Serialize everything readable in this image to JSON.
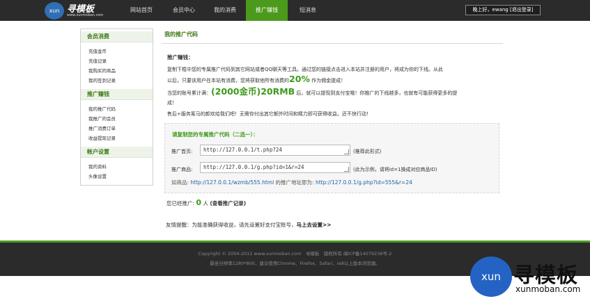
{
  "logo": {
    "mark": "xun",
    "name": "寻模板",
    "url": "www.xunmoban.com"
  },
  "nav": [
    {
      "label": "网站首页",
      "active": false
    },
    {
      "label": "会员中心",
      "active": false
    },
    {
      "label": "我的消费",
      "active": false
    },
    {
      "label": "推广赚钱",
      "active": true
    },
    {
      "label": "短消息",
      "active": false
    }
  ],
  "user": {
    "text": "晚上好，ewang [退出登录]"
  },
  "sidebar": {
    "groups": [
      {
        "title": "会员消费",
        "items": [
          "充值金币",
          "充值记录",
          "我购买的商品",
          "我的签到记录"
        ]
      },
      {
        "title": "推广赚钱",
        "items": [
          "我的推广代码",
          "我推广的会员",
          "推广消费订单",
          "收益提现记录"
        ]
      },
      {
        "title": "帐户设置",
        "items": [
          "我的资料",
          "头像设置"
        ]
      }
    ]
  },
  "main": {
    "title": "我的推广代码",
    "section_title": "推广赚钱：",
    "p1_a": "复制下框中您的专属推广代码到其它网站或者QQ聊天等工具。通过您的链接点击进入本站并注册的用户，将成为你的下线。从此",
    "p1_b": "以后，只要该用户在本站有消费，您将获取他所有消费的",
    "p1_pct": "20%",
    "p1_c": " 作为佣金提成！",
    "p2_a": "当您的账号累计满：",
    "p2_big": "(2000金币)20RMB",
    "p2_b": " 后，就可以提现到支付宝哦！你推广的下线越多，也就有可能获得更多的提",
    "p2_c": "成！",
    "p3": "售后+服务筹马的颜欢给我们吧！无需你付出其它额外时间和精力即可获得收益。还不快行动！",
    "code_box_title": "请复制您的专属推广代码（二选一）：",
    "home_label": "推广首页:",
    "home_value": "http://127.0.0.1/t.php?24",
    "home_note": "(推荐此形式)",
    "product_label": "推广商品:",
    "product_value": "http://127.0.0.1/g.php?id=1&r=24",
    "product_note": "(此为示例，请将id=1换成对应商品ID)",
    "example_prefix": "如商品:",
    "example_link1": "http://127.0.0.1/wzmb/555.html",
    "example_mid": "的推广地址即为:",
    "example_link2": "http://127.0.0.1/g.php?id=555&r=24",
    "count_prefix": "您已经推广:",
    "count_value": "0",
    "count_unit": "人",
    "count_link": "(查看推广记录)",
    "tip_text": "友情提醒：为能准确获得收益，请先设置好支付宝账号，",
    "tip_link": "马上去设置>>"
  },
  "footer": {
    "line1": "Copyright © 2004-2011 www.xunmoban.com　寻模板　版权所有 闽ICP备14079236号-2",
    "line2": "最佳分辨率1280*800，建议使用Chrome、Firefox、Safari、ie8以上版本浏览器。"
  },
  "watermark": {
    "mark": "xun",
    "name": "寻模板",
    "url": "xunmoban.com"
  },
  "colors": {
    "accent_green": "#4c9a1c",
    "dark_bar": "#2b2b2b",
    "link_blue": "#1b5fa6"
  }
}
